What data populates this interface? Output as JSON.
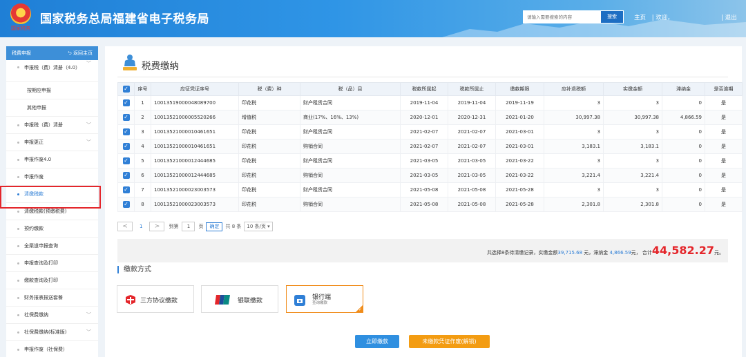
{
  "header": {
    "seal_text": "国家税务",
    "title": "国家税务总局福建省电子税务局",
    "search_placeholder": "请输入需要搜索的内容",
    "search_button": "搜索",
    "home": "主页",
    "welcome": "| 欢迎，",
    "logout": "| 退出"
  },
  "sidebar": {
    "head_label": "税费申报",
    "back_label": "返回主页",
    "items": [
      {
        "label": "申报税（费）清册（4.0）"
      },
      {
        "label": "按期应申报"
      },
      {
        "label": "其他申报"
      },
      {
        "label": "申报税（费）清册"
      },
      {
        "label": "申报更正"
      },
      {
        "label": "申报作废4.0"
      },
      {
        "label": "申报作废"
      },
      {
        "label": "清缴税款"
      },
      {
        "label": "清缴税款(预缴税费)"
      },
      {
        "label": "预约缴款"
      },
      {
        "label": "全渠道申报查询"
      },
      {
        "label": "申报查询及打印"
      },
      {
        "label": "缴款查询及打印"
      },
      {
        "label": "财务报表报送套餐"
      },
      {
        "label": "社保费缴纳"
      },
      {
        "label": "社保费缴纳(标准版)"
      },
      {
        "label": "申报作废（社保费）"
      }
    ]
  },
  "main": {
    "title": "税费缴纳",
    "columns": [
      "序号",
      "应征凭证序号",
      "税（费）种",
      "税（品）目",
      "税款所属起",
      "税款所属止",
      "缴款期限",
      "应补退税额",
      "实缴金额",
      "滞纳金",
      "是否逾期"
    ],
    "rows": [
      [
        "1",
        "10013519000048089700",
        "印花税",
        "财产租赁合同",
        "2019-11-04",
        "2019-11-04",
        "2019-11-19",
        "3",
        "3",
        "0",
        "是"
      ],
      [
        "2",
        "10013521000005520266",
        "增值税",
        "商业(17%、16%、13%)",
        "2020-12-01",
        "2020-12-31",
        "2021-01-20",
        "30,997.38",
        "30,997.38",
        "4,866.59",
        "是"
      ],
      [
        "3",
        "10013521000010461651",
        "印花税",
        "财产租赁合同",
        "2021-02-07",
        "2021-02-07",
        "2021-03-01",
        "3",
        "3",
        "0",
        "是"
      ],
      [
        "4",
        "10013521000010461651",
        "印花税",
        "购销合同",
        "2021-02-07",
        "2021-02-07",
        "2021-03-01",
        "3,183.1",
        "3,183.1",
        "0",
        "是"
      ],
      [
        "5",
        "10013521000012444685",
        "印花税",
        "财产租赁合同",
        "2021-03-05",
        "2021-03-05",
        "2021-03-22",
        "3",
        "3",
        "0",
        "是"
      ],
      [
        "6",
        "10013521000012444685",
        "印花税",
        "购销合同",
        "2021-03-05",
        "2021-03-05",
        "2021-03-22",
        "3,221.4",
        "3,221.4",
        "0",
        "是"
      ],
      [
        "7",
        "10013521000023003573",
        "印花税",
        "财产租赁合同",
        "2021-05-08",
        "2021-05-08",
        "2021-05-28",
        "3",
        "3",
        "0",
        "是"
      ],
      [
        "8",
        "10013521000023003573",
        "印花税",
        "购销合同",
        "2021-05-08",
        "2021-05-08",
        "2021-05-28",
        "2,301.8",
        "2,301.8",
        "0",
        "是"
      ]
    ],
    "pager": {
      "prev": "<",
      "page": "1",
      "next": ">",
      "goto_label": "到第",
      "goto_value": "1",
      "page_unit": "页",
      "confirm": "确定",
      "total": "共 8 条",
      "page_size": "10 条/页 ▾"
    },
    "summary": {
      "prefix": "共选择8条待清缴记录，实缴金额",
      "paid": "39,715.68",
      "mid1": " 元，滞纳金 ",
      "late_fee": "4,866.59",
      "mid2": "元， 合计",
      "total": "44,582.27",
      "suffix": "元。"
    },
    "payment": {
      "section_title": "缴款方式",
      "methods": [
        {
          "label": "三方协议缴款"
        },
        {
          "label": "银联缴款"
        },
        {
          "label": "银行端",
          "sub": "查询缴款"
        }
      ],
      "pay_now": "立即缴款",
      "void_unpaid": "未缴款凭证作废(解锁)"
    }
  },
  "colors": {
    "primary": "#2f7fd6",
    "header": "#1f7fd6",
    "accent": "#f39c12",
    "alert": "#e4262b"
  }
}
